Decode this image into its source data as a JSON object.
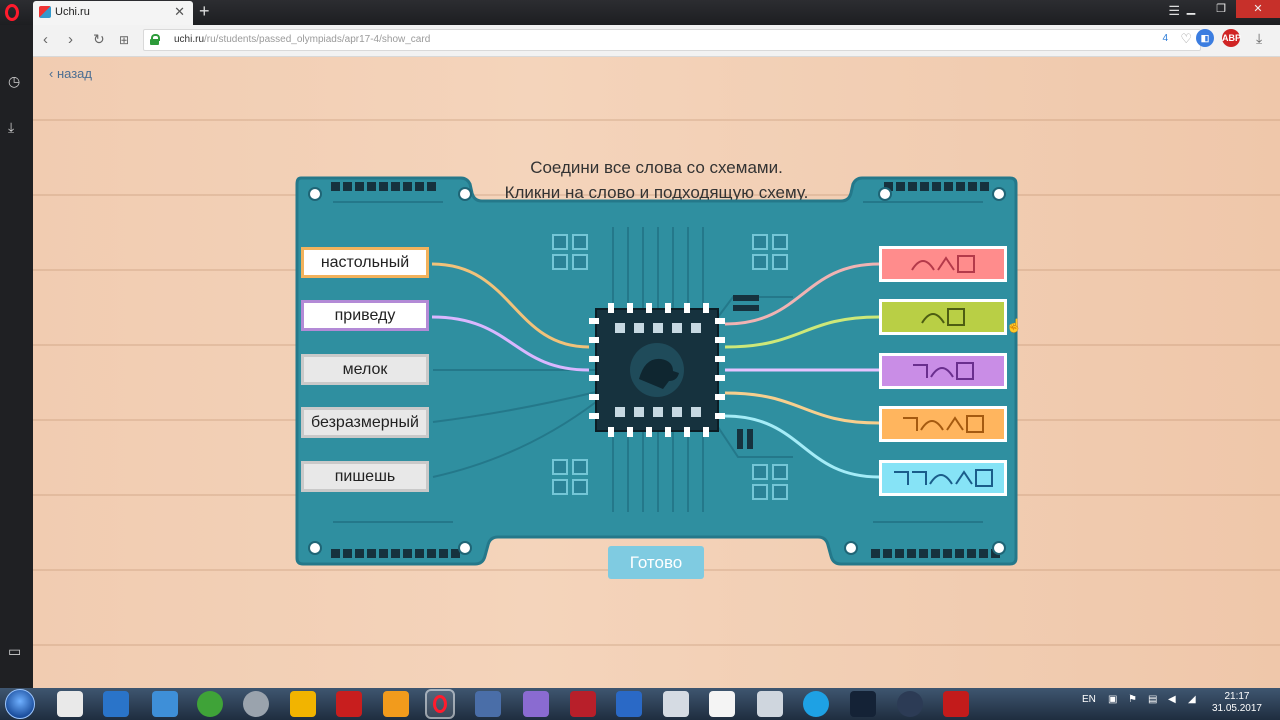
{
  "browser": {
    "tab_title": "Uchi.ru",
    "url_domain": "uchi.ru",
    "url_path": "/ru/students/passed_olympiads/apr17-4/show_card",
    "badge_count": "4",
    "ext_label": "ABP"
  },
  "page": {
    "back_label": "назад",
    "instruction_line1": "Соедини все слова со схемами.",
    "instruction_line2": "Кликни на слово и подходящую схему.",
    "ready_button": "Готово"
  },
  "words": [
    {
      "label": "настольный",
      "border": "#f2b25c",
      "connected": true
    },
    {
      "label": "приведу",
      "border": "#b38ad6",
      "connected": true
    },
    {
      "label": "мелок",
      "border": "#c9c9c9",
      "connected": false
    },
    {
      "label": "безразмерный",
      "border": "#c9c9c9",
      "connected": false
    },
    {
      "label": "пишешь",
      "border": "#c9c9c9",
      "connected": false
    }
  ],
  "schemes": [
    {
      "pattern": [
        "arc",
        "caret",
        "square"
      ],
      "color": "#ff8c8c",
      "symbol": "#b43a4a"
    },
    {
      "pattern": [
        "arc",
        "square"
      ],
      "color": "#b9cf45",
      "symbol": "#4d5d12"
    },
    {
      "pattern": [
        "prefix",
        "arc",
        "square"
      ],
      "color": "#c98de6",
      "symbol": "#6a2f8e"
    },
    {
      "pattern": [
        "prefix",
        "arc",
        "caret",
        "square"
      ],
      "color": "#ffb55e",
      "symbol": "#a55a10"
    },
    {
      "pattern": [
        "prefix",
        "prefix",
        "arc",
        "caret",
        "square"
      ],
      "color": "#86e3f6",
      "symbol": "#1a5d8a"
    }
  ],
  "wires": [
    {
      "from": 0,
      "color": "#f1c27a"
    },
    {
      "from": 1,
      "color": "#d9b7ff"
    },
    {
      "to": 0,
      "color": "#f0b3b3"
    },
    {
      "to": 1,
      "color": "#cde879"
    },
    {
      "to": 2,
      "color": "#e6c3ff"
    },
    {
      "to": 3,
      "color": "#f7cf8e"
    },
    {
      "to": 4,
      "color": "#a4ecf7"
    }
  ],
  "colors": {
    "board": "#2f8fa0",
    "board_dark": "#24788a",
    "chip": "#16323e"
  },
  "taskbar": {
    "lang": "EN",
    "time": "21:17",
    "date": "31.05.2017"
  }
}
